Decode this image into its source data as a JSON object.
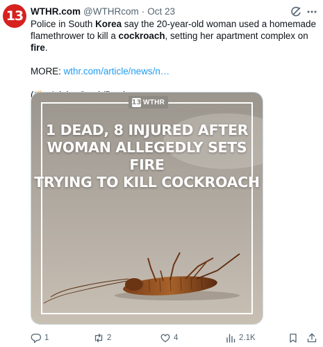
{
  "tweet": {
    "avatar_text": "13",
    "name": "WTHR.com",
    "handle": "@WTHRcom",
    "separator": "·",
    "date": "Oct 23",
    "text": {
      "l1_a": "Police in South ",
      "l1_b": "Korea",
      "l1_c": " say the 20-year-old woman used a homemade",
      "l2_a": "flamethrower to kill a ",
      "l2_b": "cockroach",
      "l2_c": ", setting her apartment complex on ",
      "l2_d": "fire",
      "l2_e": ".",
      "more_label": "MORE: ",
      "more_link": "wthr.com/article/news/n…",
      "credit": "(📸: Adobe Stock/fleur)"
    },
    "media": {
      "logo_number": "13",
      "logo_text": "WTHR",
      "headline": "1 DEAD, 8 INJURED AFTER\nWOMAN ALLEGEDLY SETS FIRE\nTRYING TO KILL COCKROACH"
    },
    "actions": {
      "replies": "1",
      "reposts": "2",
      "likes": "4",
      "views": "2.1K"
    },
    "icons": {
      "grok": "grok-icon",
      "more": "more-horizontal-icon",
      "reply": "reply-icon",
      "repost": "repost-icon",
      "like": "heart-icon",
      "views": "views-chart-icon",
      "bookmark": "bookmark-icon",
      "share": "share-icon"
    },
    "colors": {
      "brand_red": "#d6211f",
      "link": "#1d9bf0",
      "muted": "#536471"
    }
  }
}
